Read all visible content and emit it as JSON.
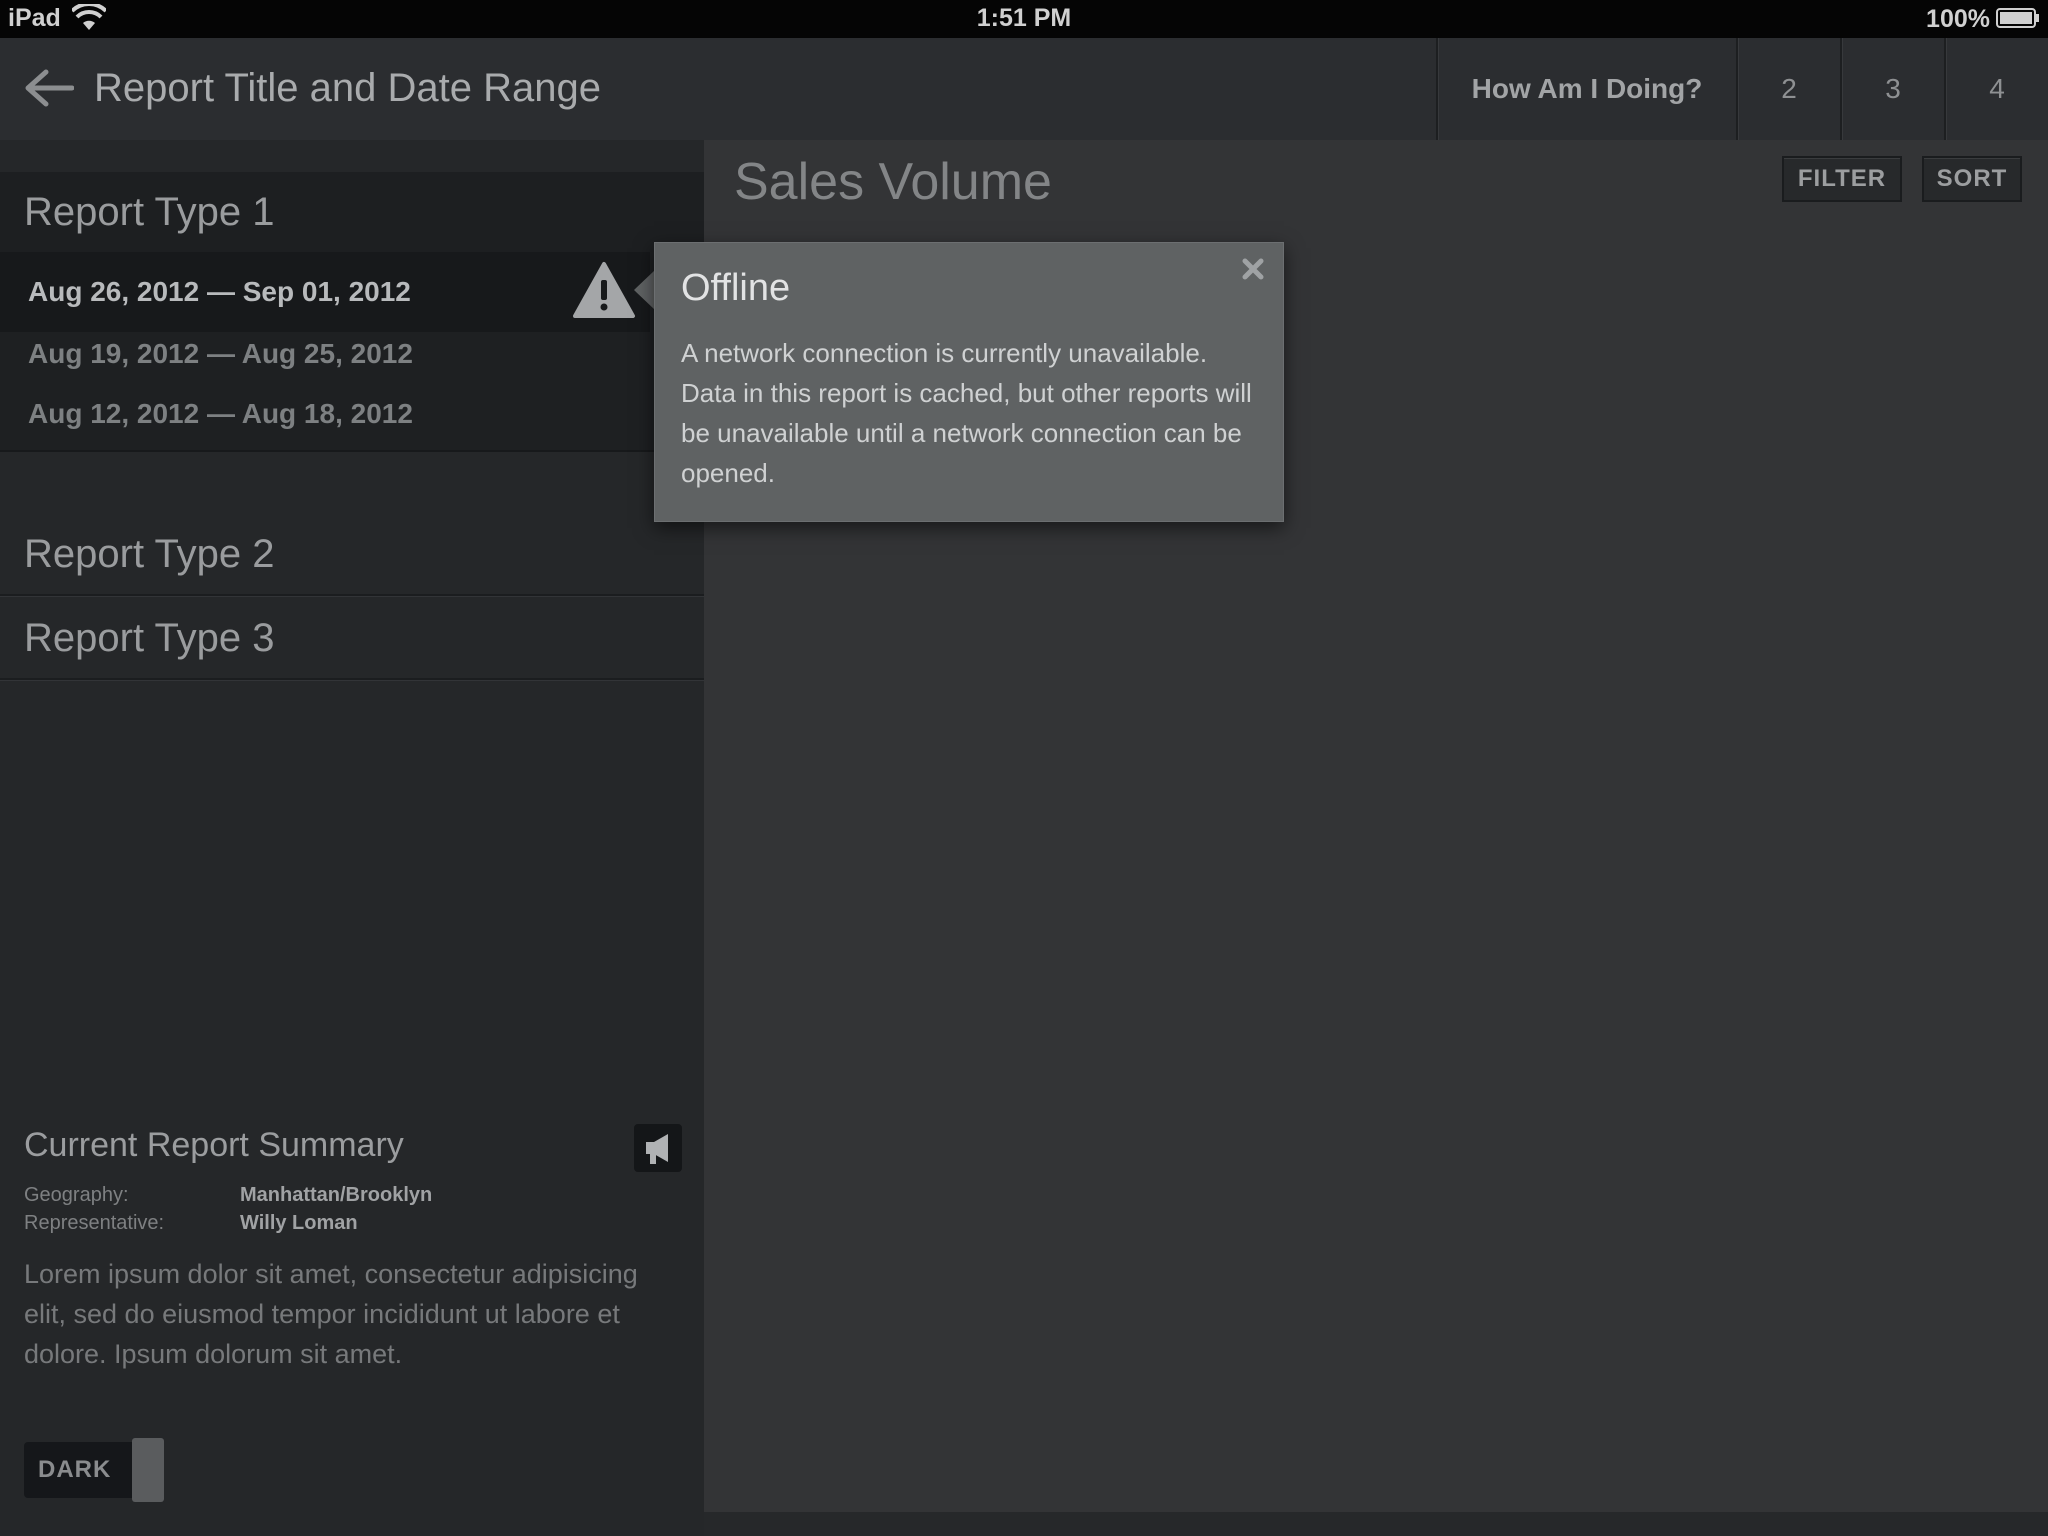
{
  "status_bar": {
    "device": "iPad",
    "time": "1:51 PM",
    "battery": "100%",
    "icons": [
      "wifi-icon",
      "battery-icon"
    ]
  },
  "header": {
    "title": "Report Title and Date Range",
    "back_icon": "arrow-left-icon",
    "tabs": [
      {
        "label": "How Am I Doing?"
      },
      {
        "label": "2"
      },
      {
        "label": "3"
      },
      {
        "label": "4"
      }
    ]
  },
  "sidebar": {
    "sections": [
      {
        "label": "Report Type 1"
      },
      {
        "label": "Report Type 2"
      },
      {
        "label": "Report Type 3"
      }
    ],
    "date_ranges": [
      {
        "label": "Aug 26, 2012 — Sep 01, 2012",
        "selected": true,
        "icon": "warning-icon"
      },
      {
        "label": "Aug 19, 2012 — Aug 25, 2012"
      },
      {
        "label": "Aug 12, 2012 — Aug 18, 2012"
      }
    ],
    "summary": {
      "title": "Current Report Summary",
      "icon": "megaphone-icon",
      "rows": [
        {
          "label": "Geography:",
          "value": "Manhattan/Brooklyn"
        },
        {
          "label": "Representative:",
          "value": "Willy Loman"
        }
      ],
      "text": "Lorem ipsum dolor sit amet, consectetur adipisicing elit, sed do eiusmod tempor incididunt ut labore et dolore. Ipsum dolorum sit amet."
    },
    "toggle": {
      "label": "DARK"
    }
  },
  "main": {
    "title": "Sales Volume",
    "filter_label": "FILTER",
    "sort_label": "SORT"
  },
  "popover": {
    "title": "Offline",
    "close_icon": "close-icon",
    "body": "A network connection is currently unavailable. Data in this report is cached, but other reports will be unavailable until a network connection can be opened."
  },
  "colors": {
    "background": "#26282a",
    "panel": "#333436",
    "popover": "#5f6263",
    "status_bar": "#050505"
  }
}
